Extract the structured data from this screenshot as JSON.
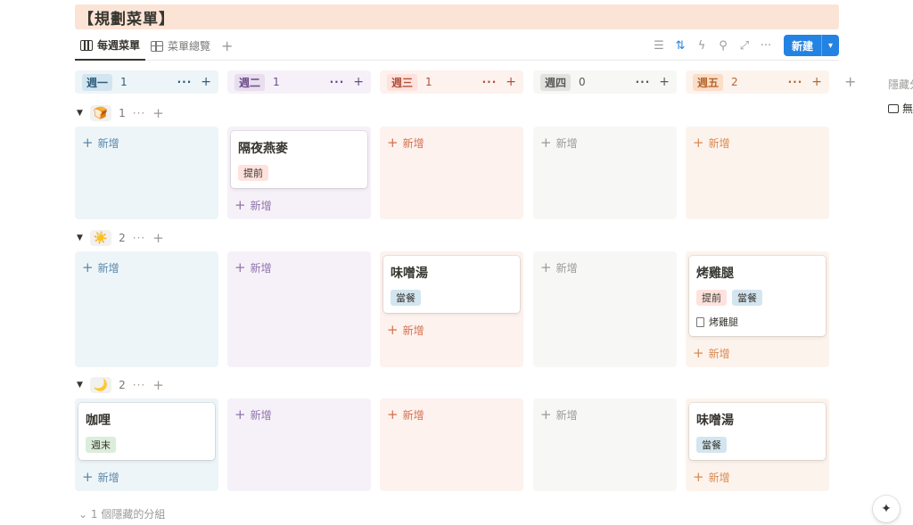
{
  "page_title": "【規劃菜單】",
  "tabs": [
    {
      "label": "每週菜單",
      "icon": "board-view-icon",
      "active": true
    },
    {
      "label": "菜單總覽",
      "icon": "table-view-icon",
      "active": false
    }
  ],
  "toolbar": {
    "icons": [
      "filter-icon",
      "sort-icon",
      "automation-icon",
      "search-icon",
      "expand-icon",
      "more-icon"
    ],
    "new_label": "新建"
  },
  "columns": [
    {
      "label": "週一",
      "count": "1",
      "bg": "#eef5f8",
      "chip": "#d3e5ef",
      "color": "#2e5d7c"
    },
    {
      "label": "週二",
      "count": "1",
      "bg": "#f6f1f9",
      "chip": "#e8deee",
      "color": "#6c4b8a"
    },
    {
      "label": "週三",
      "count": "1",
      "bg": "#fdf2ee",
      "chip": "#ffe2dd",
      "color": "#b3503a"
    },
    {
      "label": "週四",
      "count": "0",
      "bg": "#f7f7f5",
      "chip": "#e3e2e0",
      "color": "#5a5a57"
    },
    {
      "label": "週五",
      "count": "2",
      "bg": "#fdf3ed",
      "chip": "#fadec9",
      "color": "#b7662d"
    }
  ],
  "add_label": "新增",
  "hidden_groups_label": "隱藏分",
  "hidden_group_item": "無",
  "groups": [
    {
      "emoji": "🍞",
      "count": "1"
    },
    {
      "emoji": "☀️",
      "count": "2"
    },
    {
      "emoji": "🌙",
      "count": "2"
    }
  ],
  "cards": [
    {
      "title": "隔夜燕麥",
      "tags": [
        {
          "text": "提前",
          "bg": "#ffe2dd"
        }
      ]
    },
    {
      "title": "味噌湯",
      "tags": [
        {
          "text": "當餐",
          "bg": "#d3e5ef"
        }
      ]
    },
    {
      "title": "烤雞腿",
      "tags": [
        {
          "text": "提前",
          "bg": "#ffe2dd"
        },
        {
          "text": "當餐",
          "bg": "#d3e5ef"
        }
      ],
      "page": "烤雞腿"
    },
    {
      "title": "咖哩",
      "tags": [
        {
          "text": "週末",
          "bg": "#dbeddb"
        }
      ]
    },
    {
      "title": "味噌湯",
      "tags": [
        {
          "text": "當餐",
          "bg": "#d3e5ef"
        }
      ]
    }
  ],
  "footer": {
    "hidden_groups": "1 個隱藏的分組"
  }
}
